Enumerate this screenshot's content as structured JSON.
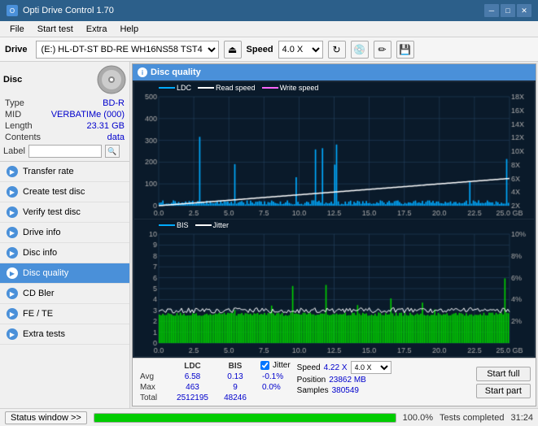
{
  "titleBar": {
    "title": "Opti Drive Control 1.70",
    "minLabel": "─",
    "maxLabel": "□",
    "closeLabel": "✕"
  },
  "menuBar": {
    "items": [
      "File",
      "Start test",
      "Extra",
      "Help"
    ]
  },
  "toolbar": {
    "driveLabel": "Drive",
    "driveValue": "(E:)  HL-DT-ST BD-RE  WH16NS58 TST4",
    "speedLabel": "Speed",
    "speedValue": "4.0 X"
  },
  "sidebar": {
    "disc": {
      "title": "Disc",
      "type_label": "Type",
      "type_value": "BD-R",
      "mid_label": "MID",
      "mid_value": "VERBATIMe (000)",
      "length_label": "Length",
      "length_value": "23.31 GB",
      "contents_label": "Contents",
      "contents_value": "data",
      "label_label": "Label"
    },
    "navItems": [
      {
        "id": "transfer-rate",
        "label": "Transfer rate",
        "active": false
      },
      {
        "id": "create-test-disc",
        "label": "Create test disc",
        "active": false
      },
      {
        "id": "verify-test-disc",
        "label": "Verify test disc",
        "active": false
      },
      {
        "id": "drive-info",
        "label": "Drive info",
        "active": false
      },
      {
        "id": "disc-info",
        "label": "Disc info",
        "active": false
      },
      {
        "id": "disc-quality",
        "label": "Disc quality",
        "active": true
      },
      {
        "id": "cd-bler",
        "label": "CD Bler",
        "active": false
      },
      {
        "id": "fe-te",
        "label": "FE / TE",
        "active": false
      },
      {
        "id": "extra-tests",
        "label": "Extra tests",
        "active": false
      }
    ]
  },
  "discQuality": {
    "title": "Disc quality",
    "legend": {
      "ldc": "LDC",
      "readSpeed": "Read speed",
      "writeSpeed": "Write speed"
    },
    "legend2": {
      "bis": "BIS",
      "jitter": "Jitter"
    },
    "yAxisTop": [
      "500",
      "400",
      "300",
      "200",
      "100",
      "0"
    ],
    "yAxisRight": [
      "18X",
      "16X",
      "14X",
      "12X",
      "10X",
      "8X",
      "6X",
      "4X",
      "2X"
    ],
    "yAxisBottom": [
      "10",
      "9",
      "8",
      "7",
      "6",
      "5",
      "4",
      "3",
      "2",
      "1"
    ],
    "yAxisBottomRight": [
      "10%",
      "8%",
      "6%",
      "4%",
      "2%"
    ],
    "xAxis": [
      "0.0",
      "2.5",
      "5.0",
      "7.5",
      "10.0",
      "12.5",
      "15.0",
      "17.5",
      "20.0",
      "22.5",
      "25.0 GB"
    ]
  },
  "stats": {
    "headers": [
      "",
      "LDC",
      "BIS",
      "",
      "Jitter",
      "Speed",
      ""
    ],
    "avg": {
      "label": "Avg",
      "ldc": "6.58",
      "bis": "0.13",
      "jitter": "-0.1%",
      "speed_label": "Speed",
      "speed_value": "4.22 X",
      "speed_select": "4.0 X"
    },
    "max": {
      "label": "Max",
      "ldc": "463",
      "bis": "9",
      "jitter": "0.0%",
      "pos_label": "Position",
      "pos_value": "23862 MB"
    },
    "total": {
      "label": "Total",
      "ldc": "2512195",
      "bis": "48246",
      "samples_label": "Samples",
      "samples_value": "380549"
    },
    "jitterChecked": true,
    "startFull": "Start full",
    "startPart": "Start part"
  },
  "statusBar": {
    "windowBtn": "Status window >>",
    "progressPercent": 100,
    "statusText": "Tests completed",
    "time": "31:24"
  }
}
